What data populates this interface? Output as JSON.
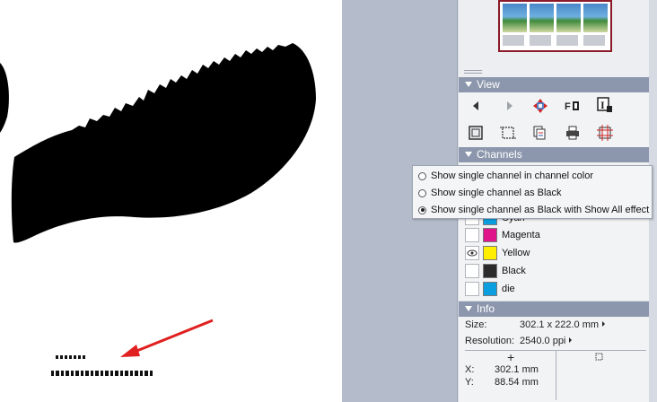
{
  "view_section": {
    "title": "View",
    "tools": [
      {
        "icon": "previous-page-icon"
      },
      {
        "icon": "next-page-icon"
      },
      {
        "icon": "move-arrows-icon"
      },
      {
        "icon": "fit-page-icon"
      },
      {
        "icon": "info-i-icon"
      },
      {
        "icon": "page-frame-icon"
      },
      {
        "icon": "crop-box-icon"
      },
      {
        "icon": "separations-icon"
      },
      {
        "icon": "printer-icon"
      },
      {
        "icon": "grid-marks-icon"
      }
    ]
  },
  "channels_section": {
    "title": "Channels",
    "menu_options": [
      {
        "label": "Show single channel in channel color",
        "selected": false
      },
      {
        "label": "Show single channel as Black",
        "selected": false
      },
      {
        "label": "Show single channel as Black with Show All effect",
        "selected": true
      }
    ],
    "channels": [
      {
        "name": "Cyan",
        "color": "#0b9fe0",
        "visible": false
      },
      {
        "name": "Magenta",
        "color": "#e0158a",
        "visible": false
      },
      {
        "name": "Yellow",
        "color": "#ffee00",
        "visible": true
      },
      {
        "name": "Black",
        "color": "#2b2b2b",
        "visible": false
      },
      {
        "name": "die",
        "color": "#0b9fe0",
        "visible": false
      }
    ]
  },
  "info_section": {
    "title": "Info",
    "size_label": "Size:",
    "size_value": "302.1 x 222.0 mm",
    "resolution_label": "Resolution:",
    "resolution_value": "2540.0 ppi",
    "x_label": "X:",
    "x_value": "302.1 mm",
    "y_label": "Y:",
    "y_value": "88.54 mm"
  },
  "colors": {
    "header_bg": "#8c97ad",
    "gutter_bg": "#b4bccb",
    "annotation_arrow": "#e02020"
  }
}
